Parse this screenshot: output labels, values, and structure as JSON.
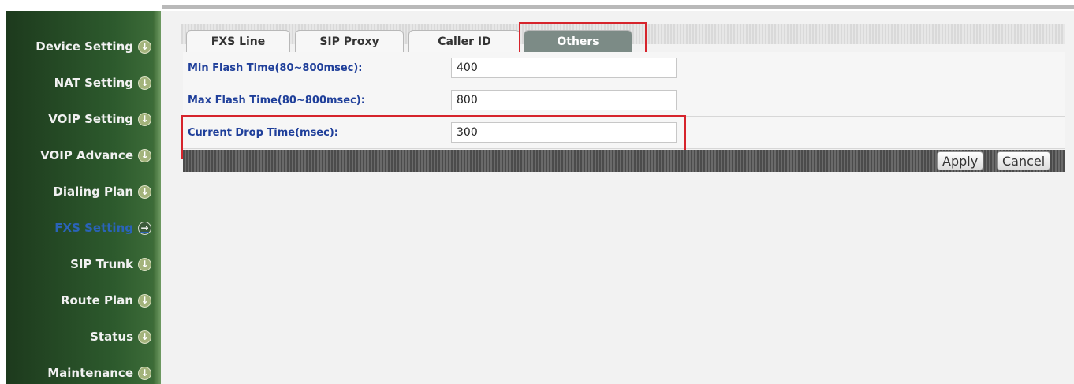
{
  "sidebar": {
    "items": [
      {
        "label": "Device Setting"
      },
      {
        "label": "NAT Setting"
      },
      {
        "label": "VOIP Setting"
      },
      {
        "label": "VOIP Advance"
      },
      {
        "label": "Dialing Plan"
      },
      {
        "label": "FXS Setting",
        "active": true
      },
      {
        "label": "SIP Trunk"
      },
      {
        "label": "Route Plan"
      },
      {
        "label": "Status"
      },
      {
        "label": "Maintenance"
      }
    ],
    "icons": {
      "default": "down-arrow-circle-icon",
      "active": "right-arrow-circle-icon"
    }
  },
  "tabs": [
    {
      "label": "FXS Line"
    },
    {
      "label": "SIP Proxy"
    },
    {
      "label": "Caller ID"
    },
    {
      "label": "Others",
      "active": true
    }
  ],
  "form": {
    "fields": [
      {
        "label": "Min Flash Time(80~800msec):",
        "value": "400"
      },
      {
        "label": "Max Flash Time(80~800msec):",
        "value": "800"
      },
      {
        "label": "Current Drop Time(msec):",
        "value": "300"
      }
    ]
  },
  "buttons": {
    "apply": "Apply",
    "cancel": "Cancel"
  },
  "colors": {
    "highlight": "#d6242c",
    "sidebar": "#2d5a2d",
    "label_text": "#1f3f9a"
  }
}
